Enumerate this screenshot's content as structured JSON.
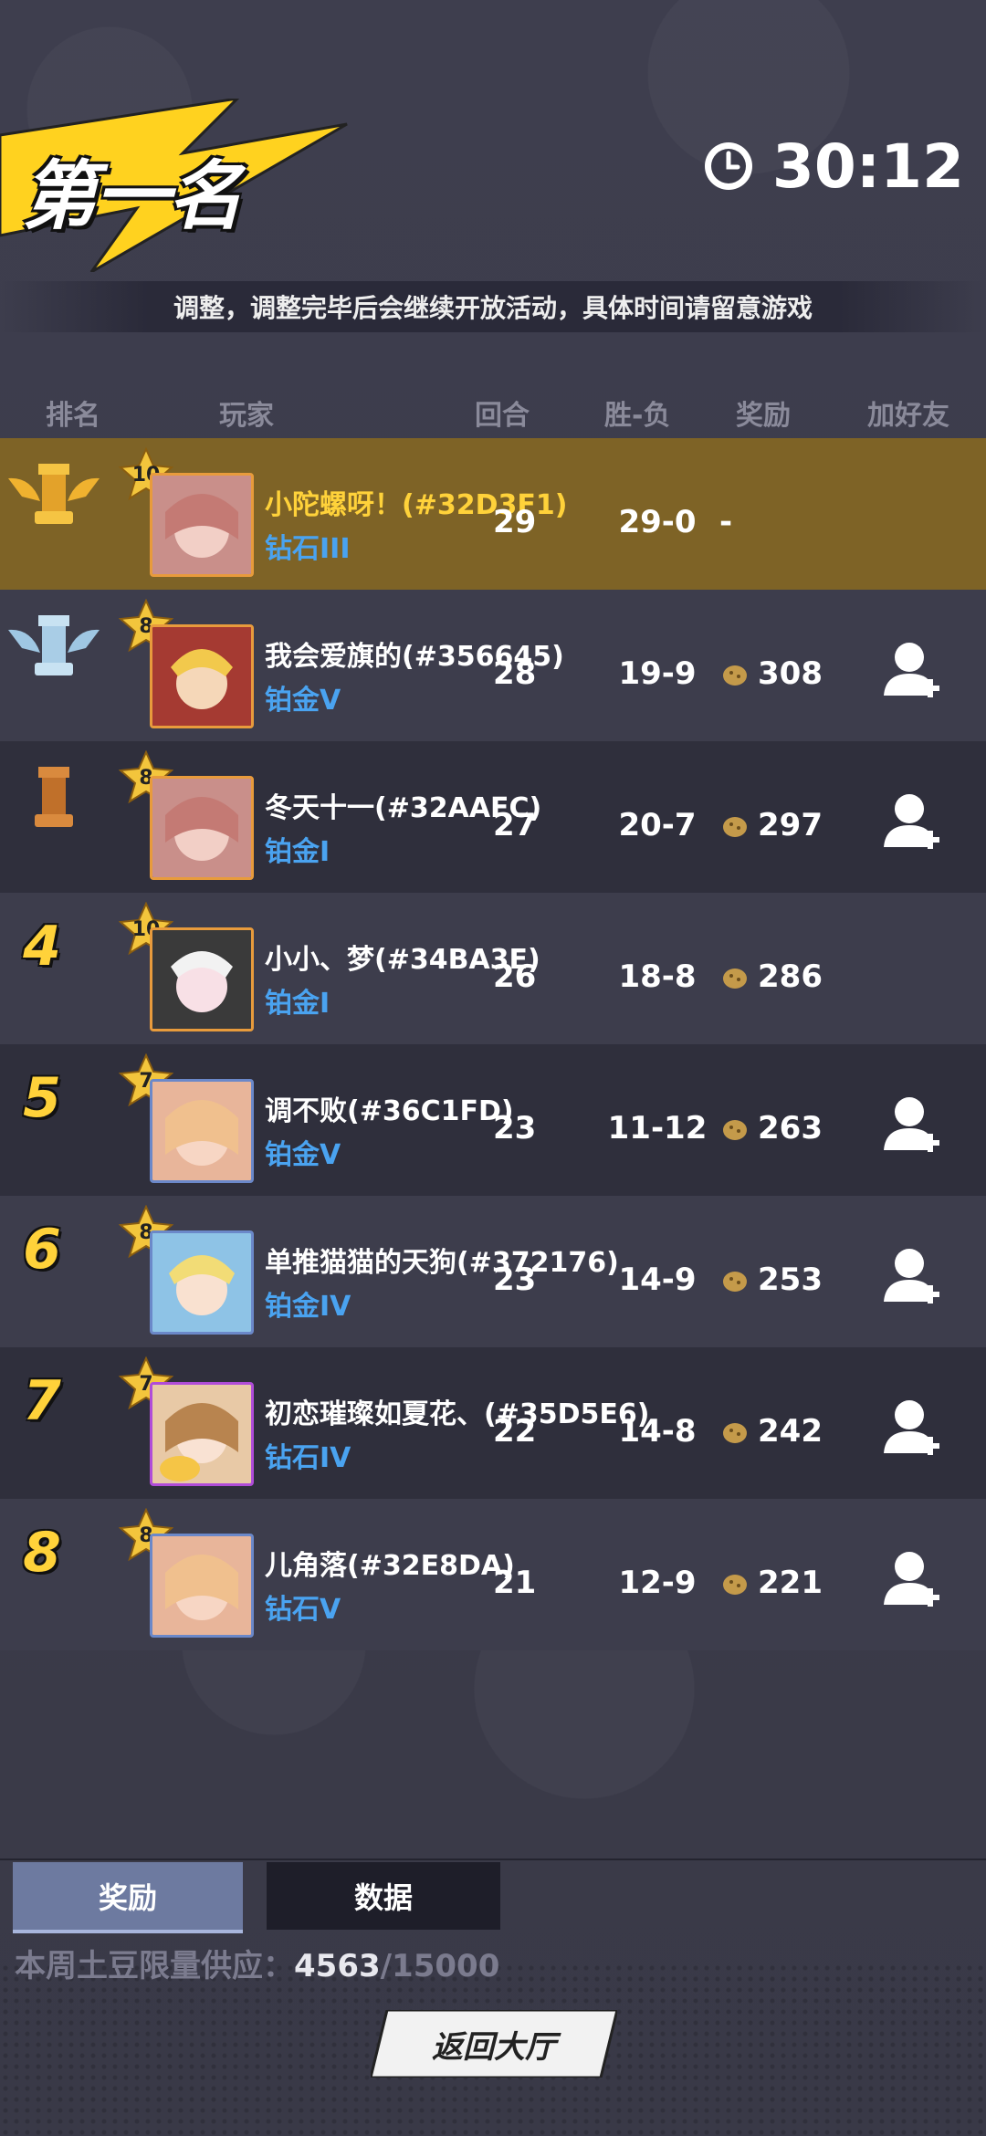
{
  "header": {
    "title": "第一名",
    "timer": "30:12",
    "notice": "调整，调整完毕后会继续开放活动，具体时间请留意游戏"
  },
  "columns": {
    "rank": "排名",
    "player": "玩家",
    "rounds": "回合",
    "win_loss": "胜-负",
    "reward": "奖励",
    "add_friend": "加好友"
  },
  "rows": [
    {
      "rank": "1",
      "level": "10",
      "name": "小陀螺呀！(#32D3F1)",
      "tier": "钻石III",
      "rounds": "29",
      "wl": "29-0",
      "reward": "-",
      "add_friend": false,
      "trophy": "gold-trophy-icon"
    },
    {
      "rank": "2",
      "level": "8",
      "name": "我会爱旗的(#356645)",
      "tier": "铂金V",
      "rounds": "28",
      "wl": "19-9",
      "reward": "308",
      "add_friend": true,
      "trophy": "silver-trophy-icon"
    },
    {
      "rank": "3",
      "level": "8",
      "name": "冬天十一(#32AAFC)",
      "tier": "铂金I",
      "rounds": "27",
      "wl": "20-7",
      "reward": "297",
      "add_friend": true,
      "trophy": "bronze-trophy-icon"
    },
    {
      "rank": "4",
      "level": "10",
      "name": "小小、梦(#34BA3E)",
      "tier": "铂金I",
      "rounds": "26",
      "wl": "18-8",
      "reward": "286",
      "add_friend": false
    },
    {
      "rank": "5",
      "level": "7",
      "name": "调不败(#36C1FD)",
      "tier": "铂金V",
      "rounds": "23",
      "wl": "11-12",
      "reward": "263",
      "add_friend": true
    },
    {
      "rank": "6",
      "level": "8",
      "name": "单推猫猫的天狗(#372176)",
      "tier": "铂金IV",
      "rounds": "23",
      "wl": "14-9",
      "reward": "253",
      "add_friend": true
    },
    {
      "rank": "7",
      "level": "7",
      "name": "初恋璀璨如夏花、(#35D5E6)",
      "tier": "钻石IV",
      "rounds": "22",
      "wl": "14-8",
      "reward": "242",
      "add_friend": true
    },
    {
      "rank": "8",
      "level": "8",
      "name": "儿角落(#32E8DA)",
      "tier": "钻石V",
      "rounds": "21",
      "wl": "12-9",
      "reward": "221",
      "add_friend": true
    }
  ],
  "tabs": {
    "reward": "奖励",
    "data": "数据"
  },
  "supply": {
    "label": "本周土豆限量供应：",
    "current": "4563",
    "total": "/15000"
  },
  "return_button": "返回大厅",
  "colors": {
    "gold_row": "#7e6326",
    "rank_yellow": "#ffd23a",
    "tier_blue": "#4aa3f0"
  }
}
